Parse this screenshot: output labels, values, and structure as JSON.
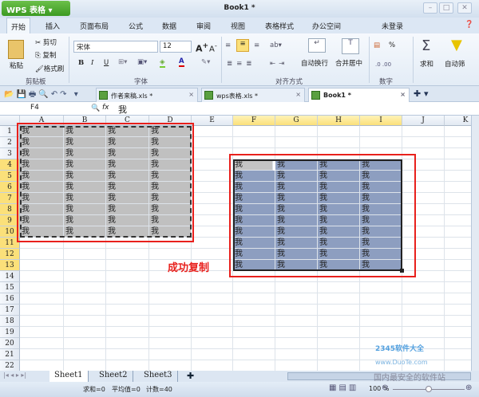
{
  "app": {
    "name": "WPS 表格",
    "title": "Book1 *"
  },
  "menu": [
    "开始",
    "插入",
    "页面布局",
    "公式",
    "数据",
    "审阅",
    "视图",
    "表格样式",
    "办公空间"
  ],
  "login": "未登录",
  "ribbon": {
    "paste": "粘贴",
    "cut": "剪切",
    "copy": "复制",
    "format_painter": "格式刷",
    "clipboard": "剪贴板",
    "font_name": "宋体",
    "font_size": "12",
    "font_group": "字体",
    "bold": "B",
    "italic": "I",
    "underline": "U",
    "wrap": "自动换行",
    "merge": "合并居中",
    "align_group": "对齐方式",
    "number_group": "数字",
    "percent": "%",
    "sum": "求和",
    "autofilter": "自动筛"
  },
  "doc_tabs": [
    {
      "label": "作者来稿.xls *",
      "active": false
    },
    {
      "label": "wps表格.xls *",
      "active": false
    },
    {
      "label": "Book1 *",
      "active": true
    }
  ],
  "formula": {
    "cell": "F4",
    "fx": "fx",
    "value": "我"
  },
  "columns": [
    "A",
    "B",
    "C",
    "D",
    "E",
    "F",
    "G",
    "H",
    "I",
    "J",
    "K"
  ],
  "selected_columns": [
    "F",
    "G",
    "H",
    "I"
  ],
  "rows": 22,
  "selected_rows": [
    4,
    13
  ],
  "cell_text": "我",
  "source_range": {
    "cols": [
      "A",
      "B",
      "C",
      "D"
    ],
    "rows": [
      1,
      10
    ],
    "fill": "#c0c0c0"
  },
  "pasted_range": {
    "cols": [
      "F",
      "G",
      "H",
      "I"
    ],
    "rows": [
      4,
      13
    ],
    "fill": "#8d9ec0"
  },
  "annotation": "成功复制",
  "annotation_color": "#e8201c",
  "sheets": [
    "Sheet1",
    "Sheet2",
    "Sheet3"
  ],
  "active_sheet": "Sheet1",
  "status": {
    "sum": "求和=0",
    "avg": "平均值=0",
    "count": "计数=40",
    "zoom": "100 %"
  },
  "watermark": {
    "site": "www.DuoTe.com",
    "slogan": "国内最安全的软件站",
    "brand": "2345软件大全"
  }
}
